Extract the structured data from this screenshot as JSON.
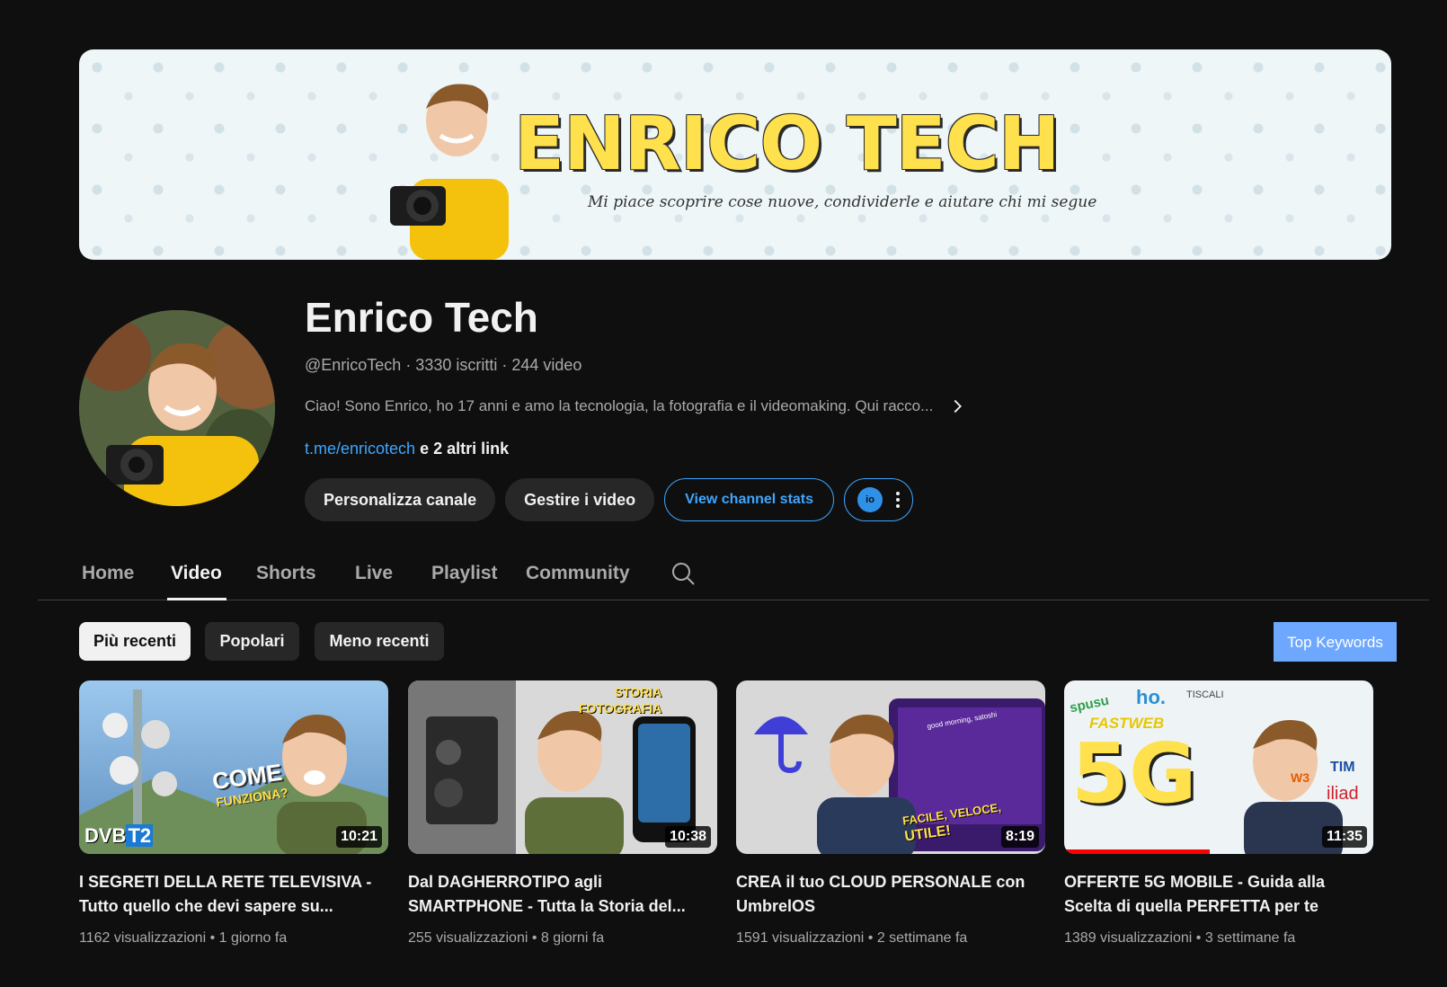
{
  "banner": {
    "title": "ENRICO TECH",
    "subtitle": "Mi piace scoprire cose nuove, condividerle e aiutare chi mi segue"
  },
  "channel": {
    "name": "Enrico Tech",
    "meta": "@EnricoTech · 3330 iscritti · 244 video",
    "description": "Ciao! Sono Enrico, ho 17 anni e amo la tecnologia, la fotografia e il videomaking. Qui racco...",
    "link": "t.me/enricotech",
    "more_links": " e 2 altri link"
  },
  "actions": {
    "customize": "Personalizza canale",
    "manage": "Gestire i video",
    "stats": "View channel stats",
    "ext_logo": "io"
  },
  "tabs": [
    "Home",
    "Video",
    "Shorts",
    "Live",
    "Playlist",
    "Community"
  ],
  "active_tab": "Video",
  "filters": [
    "Più recenti",
    "Popolari",
    "Meno recenti"
  ],
  "top_keywords": "Top Keywords",
  "videos": [
    {
      "title": "I SEGRETI DELLA RETE TELEVISIVA - Tutto quello che devi sapere su...",
      "duration": "10:21",
      "views": "1162 visualizzazioni",
      "age": "1 giorno fa",
      "thumb_text": [
        "COME",
        "FUNZIONA?",
        "DVB",
        "T2"
      ]
    },
    {
      "title": "Dal DAGHERROTIPO agli SMARTPHONE - Tutta la Storia del...",
      "duration": "10:38",
      "views": "255 visualizzazioni",
      "age": "8 giorni fa",
      "thumb_text": [
        "STORIA",
        "FOTOGRAFIA"
      ]
    },
    {
      "title": "CREA il tuo CLOUD PERSONALE con UmbrelOS",
      "duration": "8:19",
      "views": "1591 visualizzazioni",
      "age": "2 settimane fa",
      "thumb_text": [
        "FACILE, VELOCE,",
        "UTILE!",
        "good morning, satoshi"
      ]
    },
    {
      "title": "OFFERTE 5G MOBILE - Guida alla Scelta di quella PERFETTA per te",
      "duration": "11:35",
      "views": "1389 visualizzazioni",
      "age": "3 settimane fa",
      "watched_fraction": 0.47,
      "thumb_text": [
        "5G",
        "spusu",
        "ho.",
        "TISCALI",
        "FASTWEB",
        "TIM",
        "iliad",
        "W3"
      ]
    }
  ],
  "colors": {
    "background": "#0f0f0f",
    "link": "#3ea6ff",
    "chip": "#272727",
    "top_keywords": "#6ea8fe",
    "banner_title": "#ffe04d"
  },
  "icons": [
    "chevron-right-icon",
    "search-icon",
    "more-vert-icon"
  ]
}
